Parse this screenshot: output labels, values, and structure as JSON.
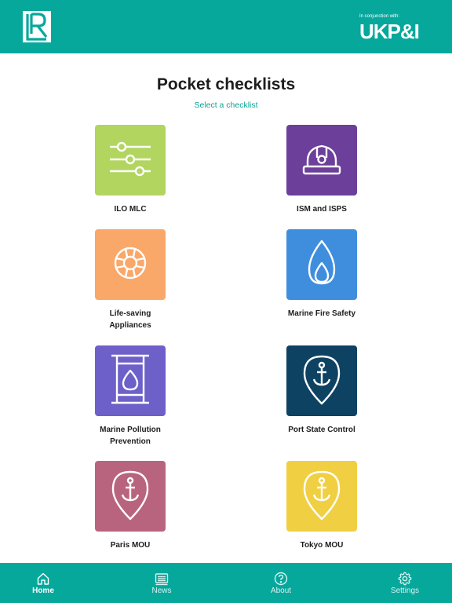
{
  "header": {
    "logo_name": "lr-logo",
    "partner_caption": "In conjunction with:",
    "partner_name": "UKP&I",
    "background": "#06a89c"
  },
  "main": {
    "title": "Pocket checklists",
    "subtitle": "Select a checklist"
  },
  "checklists": [
    {
      "label": "ILO MLC",
      "color": "#b1d55f",
      "icon": "sliders-icon"
    },
    {
      "label": "ISM and ISPS",
      "color": "#6c3f9b",
      "icon": "hard-hat-icon"
    },
    {
      "label": "Life-saving Appliances",
      "color": "#f9a86a",
      "icon": "lifebuoy-icon"
    },
    {
      "label": "Marine Fire Safety",
      "color": "#3f8ede",
      "icon": "flame-icon"
    },
    {
      "label": "Marine Pollution Prevention",
      "color": "#6d60c8",
      "icon": "oil-barrel-icon"
    },
    {
      "label": "Port State Control",
      "color": "#0e4263",
      "icon": "anchor-pin-icon"
    },
    {
      "label": "Paris MOU",
      "color": "#b9647f",
      "icon": "anchor-pin-icon"
    },
    {
      "label": "Tokyo MOU",
      "color": "#f0cf43",
      "icon": "anchor-pin-icon"
    }
  ],
  "tabbar": {
    "tabs": [
      {
        "label": "Home",
        "icon": "home-icon",
        "active": true
      },
      {
        "label": "News",
        "icon": "news-icon",
        "active": false
      },
      {
        "label": "About",
        "icon": "question-icon",
        "active": false
      },
      {
        "label": "Settings",
        "icon": "gear-icon",
        "active": false
      }
    ]
  }
}
